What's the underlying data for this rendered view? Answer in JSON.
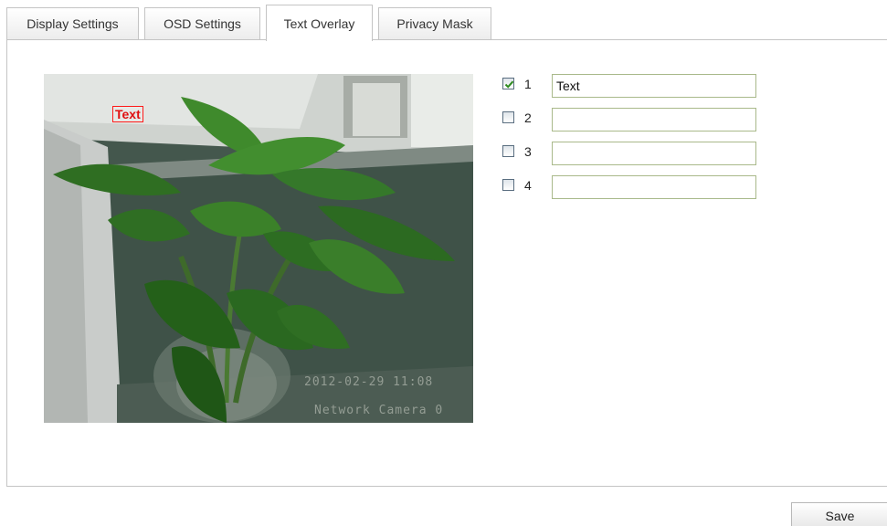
{
  "tabs": [
    {
      "label": "Display Settings",
      "active": false
    },
    {
      "label": "OSD Settings",
      "active": false
    },
    {
      "label": "Text Overlay",
      "active": true
    },
    {
      "label": "Privacy Mask",
      "active": false
    }
  ],
  "preview": {
    "overlay_text": "Text",
    "osd_datetime": "2012-02-29 11:08",
    "osd_camera_name": "Network Camera 0"
  },
  "overlays": [
    {
      "number": "1",
      "checked": true,
      "value": "Text"
    },
    {
      "number": "2",
      "checked": false,
      "value": ""
    },
    {
      "number": "3",
      "checked": false,
      "value": ""
    },
    {
      "number": "4",
      "checked": false,
      "value": ""
    }
  ],
  "actions": {
    "save_label": "Save"
  },
  "colors": {
    "overlay_box": "#ff1a1a",
    "checkmark": "#2e8b1e",
    "input_border": "#a9b98a"
  }
}
